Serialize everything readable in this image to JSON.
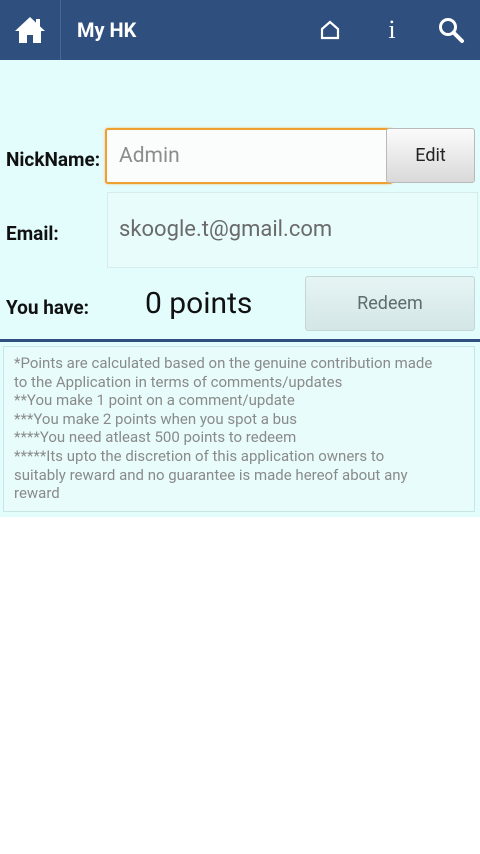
{
  "header": {
    "title": "My HK",
    "icons": {
      "home": "home-icon",
      "favorites": "house-outline-icon",
      "info": "info-icon",
      "search": "search-icon"
    },
    "info_glyph": "i"
  },
  "form": {
    "nickname_label": "NickName:",
    "nickname_value": "Admin",
    "edit_label": "Edit",
    "email_label": "Email:",
    "email_value": "skoogle.t@gmail.com",
    "points_label": "You have:",
    "points_value": "0 points",
    "redeem_label": "Redeem"
  },
  "notes": [
    "*Points are calculated based on the genuine contribution made",
    "to the Application in terms of comments/updates",
    "**You make 1 point on a comment/update",
    "***You make 2 points when you spot a bus",
    "****You need atleast 500 points to redeem",
    "*****Its upto the discretion of this application owners to",
    "suitably reward and no guarantee is made hereof about any",
    "reward"
  ],
  "colors": {
    "action_bar": "#2f4f7f",
    "content_bg": "#e3fcfc",
    "input_focus": "#f0a030"
  }
}
